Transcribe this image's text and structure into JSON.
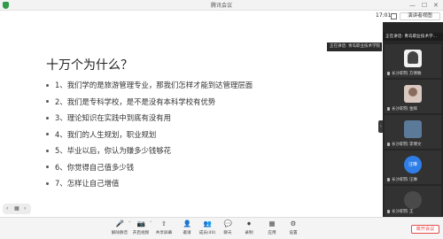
{
  "window": {
    "title": "腾讯会议",
    "controls": [
      "—",
      "☐",
      "✕"
    ]
  },
  "toolbar": {
    "timer": "17:01",
    "speaker_view_label": "演讲者视图"
  },
  "slide": {
    "title": "十万个为什么？",
    "bullets": [
      "1、我们学的是旅游管理专业，那我们怎样才能到达管理层面",
      "2、我们是专科学校，是不是没有本科学校有优势",
      "3、理论知识在实践中到底有没有用",
      "4、我们的人生规划，职业规划",
      "5、毕业以后，你认为赚多少钱够花",
      "6、你觉得自己值多少钱",
      "7、怎样让自己增值"
    ],
    "slide_controls": [
      "‹",
      "▦",
      "›"
    ]
  },
  "share_tag": "正在讲话: 青岛职业技术学院",
  "panel": {
    "speaking_now": "正在讲话: 青岛职业技术学...",
    "participants": [
      {
        "name": "长沙职院 方倩敏",
        "avatar": "person-avatar"
      },
      {
        "name": "长沙职院 金辉",
        "avatar": "photo-avatar"
      },
      {
        "name": "长沙职院 李博文",
        "avatar": "photo-avatar"
      },
      {
        "name": "长沙职院 汪琳",
        "avatar": "initials-avatar",
        "initials": "汪琳"
      },
      {
        "name": "长沙职院 王",
        "avatar": "circle-avatar"
      }
    ]
  },
  "bottombar": {
    "buttons": [
      {
        "label": "解除静音",
        "icon": "🎤"
      },
      {
        "label": "开启视频",
        "icon": "📷"
      },
      {
        "label": "共享屏幕",
        "icon": "⇧"
      },
      {
        "label": "邀请",
        "icon": "👤"
      },
      {
        "label": "成员(40)",
        "icon": "👥"
      },
      {
        "label": "聊天",
        "icon": "💬"
      },
      {
        "label": "录制",
        "icon": "⏺"
      },
      {
        "label": "应用",
        "icon": "▦"
      },
      {
        "label": "设置",
        "icon": "⚙"
      }
    ],
    "leave_label": "离开会议"
  },
  "colors": {
    "panel_bg": "#262626",
    "accent_blue": "#2f7ee8",
    "leave_red": "#e34d4d"
  }
}
